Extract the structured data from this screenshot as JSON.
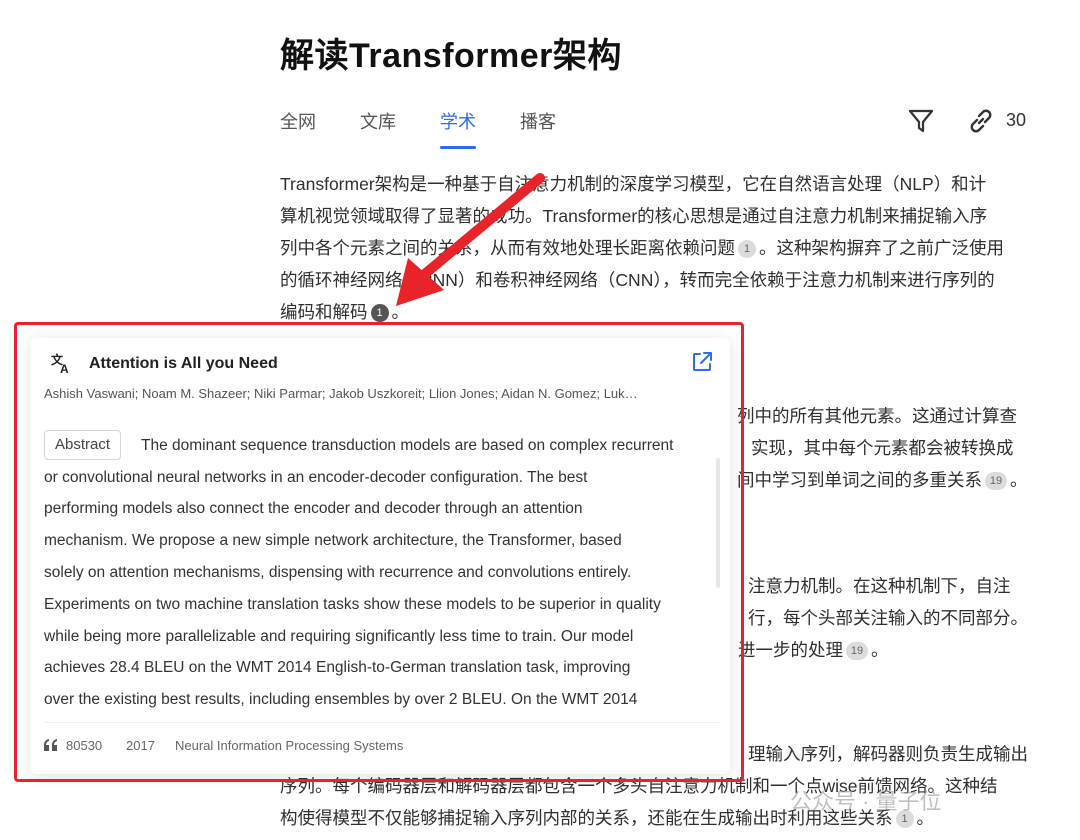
{
  "page": {
    "title": "解读Transformer架构"
  },
  "tabs": [
    {
      "label": "全网"
    },
    {
      "label": "文库"
    },
    {
      "label": "学术"
    },
    {
      "label": "播客"
    }
  ],
  "toolbar": {
    "link_count": "30"
  },
  "colors": {
    "accent": "#2a6ee8",
    "highlight": "#e8232a",
    "arrow": "#e8232a"
  },
  "icons": {
    "filter": "filter-icon",
    "link": "link-icon",
    "translate": "translate-icon",
    "external": "external-link-icon",
    "quote": "quote-icon"
  },
  "content": {
    "p1": [
      "Transformer架构是一种基于自注意力机制的深度学习模型，它在自然语言处理（NLP）和计",
      "算机视觉领域取得了显著的成功。Transformer的核心思想是通过自注意力机制来捕捉输入序",
      "列中各个元素之间的关系，从而有效地处理长距离依赖问题",
      "。这种架构摒弃了之前广泛使用",
      "的循环神经网络（RNN）和卷积神经网络（CNN），转而完全依赖于注意力机制来进行序列的",
      "编码和解码",
      "。"
    ],
    "p2": [
      "列中的所有其他元素。这通过计算查",
      "实现，其中每个元素都会被转换成",
      "间中学习到单词之间的多重关系",
      "。"
    ],
    "p3": [
      "注意力机制。在这种机制下，自注",
      "行，每个头部关注输入的不同部分。",
      "进一步的处理",
      "。"
    ],
    "p4": [
      "理输入序列，解码器则负责生成输出",
      "序列。每个编码器层和解码器层都包含一个多头自注意力机制和一个点wise前馈网络。这种结",
      "构使得模型不仅能够捕捉输入序列内部的关系，还能在生成输出时利用这些关系",
      "。"
    ],
    "citations": {
      "c1": "1",
      "c2": "1",
      "c3": "19",
      "c4": "19",
      "c5": "1"
    }
  },
  "card": {
    "title": "Attention is All you Need",
    "authors": "Ashish Vaswani; Noam M. Shazeer; Niki Parmar; Jakob Uszkoreit; Llion Jones; Aidan N. Gomez; Luk…",
    "abstract_label": "Abstract",
    "abstract_lines": [
      "The dominant sequence transduction models are based on complex recurrent",
      "or convolutional neural networks in an encoder-decoder configuration. The best",
      "performing models also connect the encoder and decoder through an attention",
      "mechanism. We propose a new simple network architecture, the Transformer, based",
      "solely on attention mechanisms, dispensing with recurrence and convolutions entirely.",
      "Experiments on two machine translation tasks show these models to be superior in quality",
      "while being more parallelizable and requiring significantly less time to train. Our model",
      "achieves 28.4 BLEU on the WMT 2014 English-to-German translation task, improving",
      "over the existing best results, including ensembles by over 2 BLEU. On the WMT 2014"
    ],
    "citations": "80530",
    "year": "2017",
    "venue": "Neural Information Processing Systems"
  },
  "watermark": "公众号 · 量子位"
}
